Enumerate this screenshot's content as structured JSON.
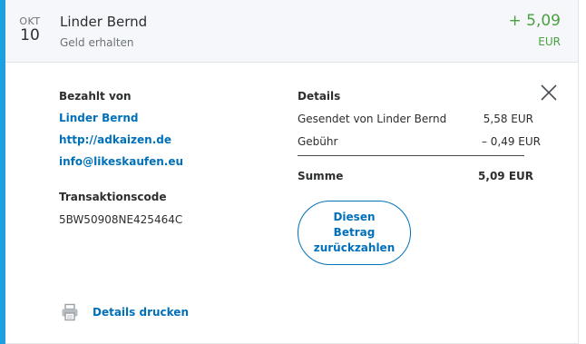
{
  "transaction": {
    "date_month": "OKT",
    "date_day": "10",
    "name": "Linder Bernd",
    "type": "Geld erhalten",
    "amount": "+ 5,09",
    "currency": "EUR"
  },
  "paid_by": {
    "heading": "Bezahlt von",
    "name": "Linder Bernd",
    "website": "http://adkaizen.de",
    "email": "info@likeskaufen.eu"
  },
  "transaction_code": {
    "heading": "Transaktionscode",
    "value": "5BW50908NE425464C"
  },
  "details": {
    "heading": "Details",
    "sent_label": "Gesendet von Linder Bernd",
    "sent_value": "5,58 EUR",
    "fee_label": "Gebühr",
    "fee_value": "– 0,49 EUR",
    "total_label": "Summe",
    "total_value": "5,09 EUR"
  },
  "actions": {
    "refund_label": "Diesen Betrag zurückzahlen",
    "print_label": "Details drucken"
  },
  "icons": {
    "close": "close-icon",
    "print": "printer-icon"
  },
  "colors": {
    "accent": "#1ea0e0",
    "link": "#0070ba",
    "positive": "#49a140"
  }
}
